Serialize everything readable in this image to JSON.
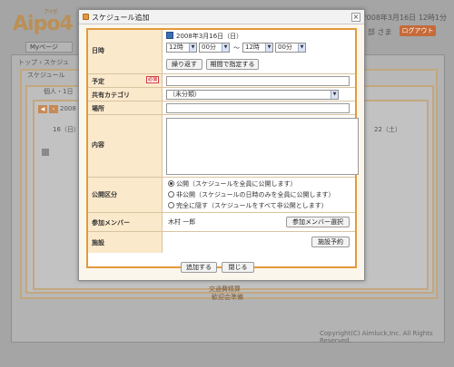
{
  "background": {
    "logo": "Aipo",
    "logo_ruby": "アイポ",
    "logo_suffix": "4",
    "header_date": "2008年3月16日 12時1分",
    "user": "部 さま",
    "logout_label": "ログアウト",
    "mypage_tab": "Myページ",
    "breadcrumb": "トップ › スケジュ",
    "box1_title": "スケジュール",
    "box2_title": "個人・1日",
    "nav_date": "2008",
    "day_left": "16（日）",
    "day_right": "22（土）",
    "events": [
      "交通費精算",
      "歓迎会準備"
    ],
    "footer": "Copyright(C) Aimluck,Inc. All Rights Reserved."
  },
  "dialog": {
    "title": "スケジュール追加",
    "close_glyph": "×",
    "date": {
      "label": "日時",
      "value": "2008年3月16日（日）",
      "start_hour": "12時",
      "start_minute": "00分",
      "separator": "〜",
      "end_hour": "12時",
      "end_minute": "00分",
      "repeat_button": "繰り返す",
      "period_button": "期間で指定する"
    },
    "plan": {
      "label": "予定",
      "required_badge": "必須",
      "value": ""
    },
    "category": {
      "label": "共有カテゴリ",
      "selected": "（未分類）"
    },
    "place": {
      "label": "場所",
      "value": ""
    },
    "content": {
      "label": "内容",
      "value": ""
    },
    "visibility": {
      "label": "公開区分",
      "options": [
        {
          "text": "公開（スケジュールを全員に公開します）",
          "selected": true
        },
        {
          "text": "非公開（スケジュールの日時のみを全員に公開します）",
          "selected": false
        },
        {
          "text": "完全に隠す（スケジュールをすべて非公開とします）",
          "selected": false
        }
      ]
    },
    "members": {
      "label": "参加メンバー",
      "value": "木村 一郎",
      "button": "参加メンバー選択"
    },
    "facility": {
      "label": "施設",
      "button": "施設予約"
    },
    "add_button": "追加する",
    "close_button": "閉じる"
  },
  "colors": {
    "accent": "#e29a3b",
    "label_bg": "#fbe9cc",
    "required": "#d23a3a",
    "logout": "#c56a3a"
  }
}
